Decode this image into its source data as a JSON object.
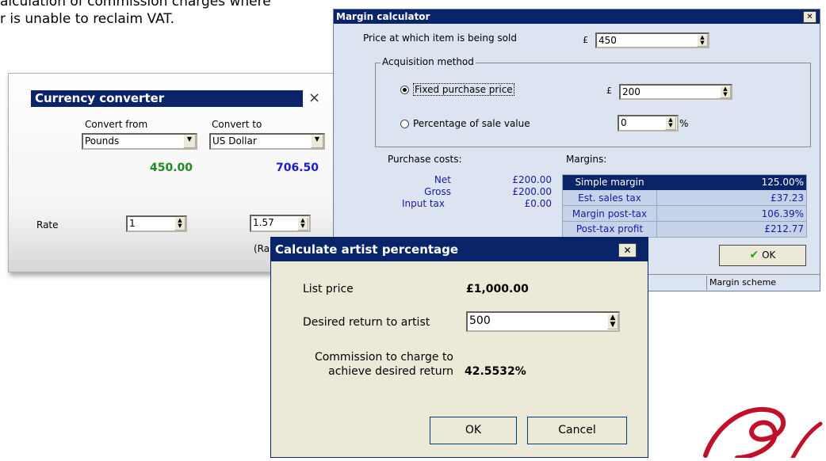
{
  "background": {
    "line1": "alculation of commission charges where",
    "line2": "r is unable to reclaim VAT."
  },
  "currency_converter": {
    "title": "Currency converter",
    "close": "×",
    "from_label": "Convert from",
    "to_label": "Convert to",
    "from_value": "Pounds",
    "to_value": "US Dollar",
    "from_amount": "450.00",
    "to_amount": "706.50",
    "rate_label": "Rate",
    "rate_from": "1",
    "rate_to": "1.57",
    "partial_label": "(Ra",
    "colors": {
      "from_amount": "#1f8a1f",
      "to_amount": "#1a1ad0",
      "title_bg": "#0a246a"
    }
  },
  "margin_calculator": {
    "title": "Margin calculator",
    "close": "✕",
    "price_label": "Price at which item is being sold",
    "currency": "£",
    "price_value": "450",
    "group_title": "Acquisition method",
    "fixed_label": "Fixed purchase price",
    "fixed_value": "200",
    "pct_label": "Percentage of sale value",
    "pct_value": "0",
    "pct_sign": "%",
    "purchase_costs_label": "Purchase costs:",
    "margins_label": "Margins:",
    "costs": [
      {
        "label": "Net",
        "value": "£200.00"
      },
      {
        "label": "Gross",
        "value": "£200.00"
      },
      {
        "label": "Input tax",
        "value": "£0.00"
      }
    ],
    "margins": [
      {
        "label": "Simple margin",
        "value": "125.00%"
      },
      {
        "label": "Est. sales tax",
        "value": "£37.23"
      },
      {
        "label": "Margin post-tax",
        "value": "106.39%"
      },
      {
        "label": "Post-tax profit",
        "value": "£212.77"
      }
    ],
    "ok_label": "OK",
    "status": "Margin scheme",
    "colors": {
      "title_bg": "#0a246a",
      "body_bg": "#dbe4f0",
      "cost_text": "#1a1aa0",
      "selected_bg": "#0a246a"
    }
  },
  "artist_percentage": {
    "title": "Calculate artist percentage",
    "close": "✕",
    "list_price_label": "List price",
    "list_price_value": "£1,000.00",
    "desired_label": "Desired return to artist",
    "desired_value": "500",
    "commission_label": "Commission to charge to achieve desired return",
    "commission_value": "42.5532%",
    "ok_label": "OK",
    "cancel_label": "Cancel",
    "colors": {
      "title_bg": "#0a246a",
      "body_bg": "#ece9d8"
    }
  }
}
